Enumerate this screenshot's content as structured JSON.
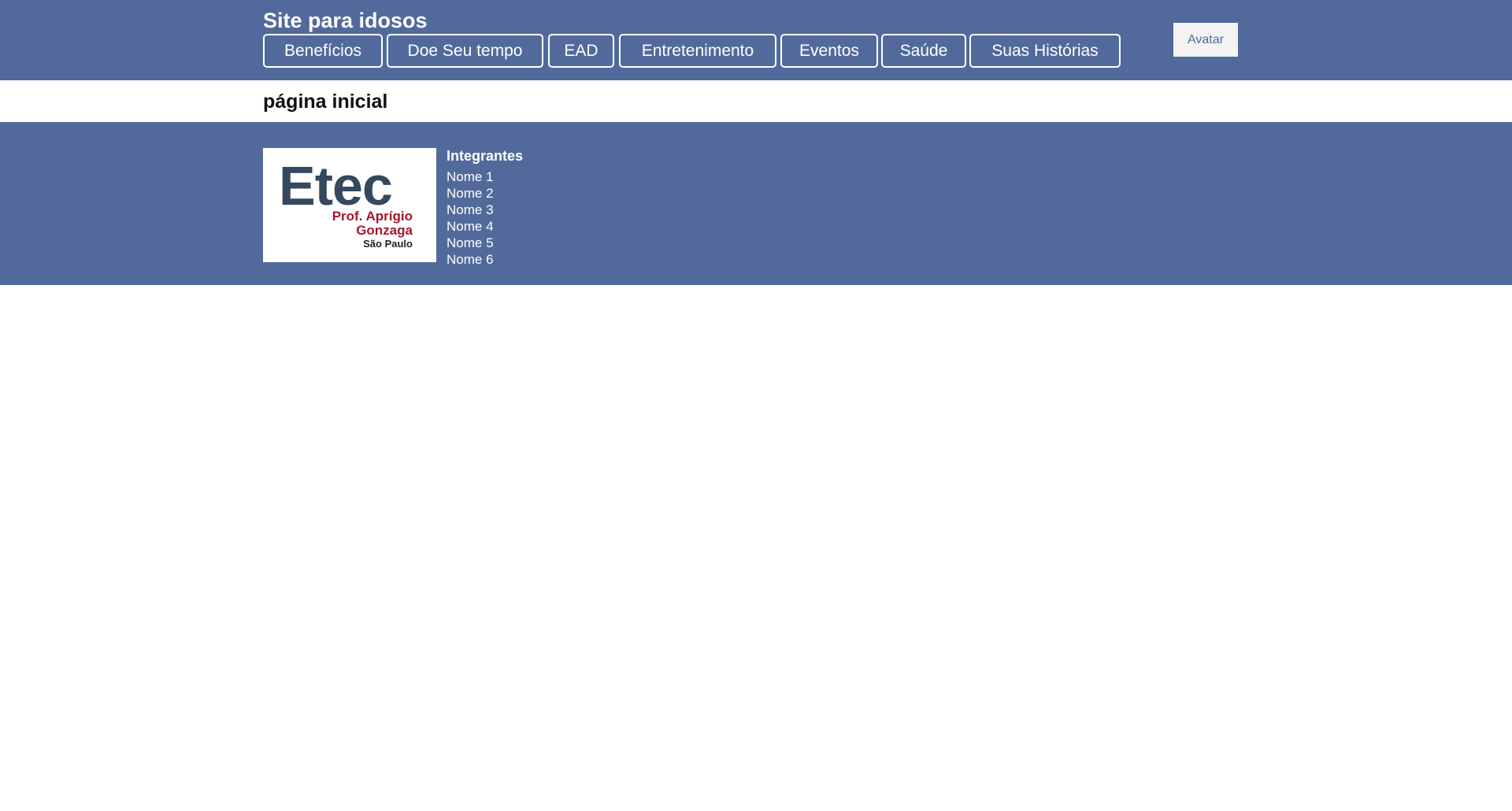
{
  "header": {
    "site_title": "Site para idosos",
    "nav": [
      {
        "label": "Benefícios"
      },
      {
        "label": "Doe Seu tempo"
      },
      {
        "label": "EAD"
      },
      {
        "label": "Entretenimento"
      },
      {
        "label": "Eventos"
      },
      {
        "label": "Saúde"
      },
      {
        "label": "Suas Histórias"
      }
    ],
    "avatar_label": "Avatar"
  },
  "page": {
    "title": "página inicial"
  },
  "footer": {
    "logo": {
      "name": "Etec",
      "line1": "Prof. Aprígio",
      "line2": "Gonzaga",
      "city": "São Paulo"
    },
    "members_title": "Integrantes",
    "members": [
      "Nome 1",
      "Nome 2",
      "Nome 3",
      "Nome 4",
      "Nome 5",
      "Nome 6"
    ]
  },
  "colors": {
    "brand": "#526a9b",
    "logo_dark": "#34495e",
    "logo_red": "#a3182d"
  }
}
